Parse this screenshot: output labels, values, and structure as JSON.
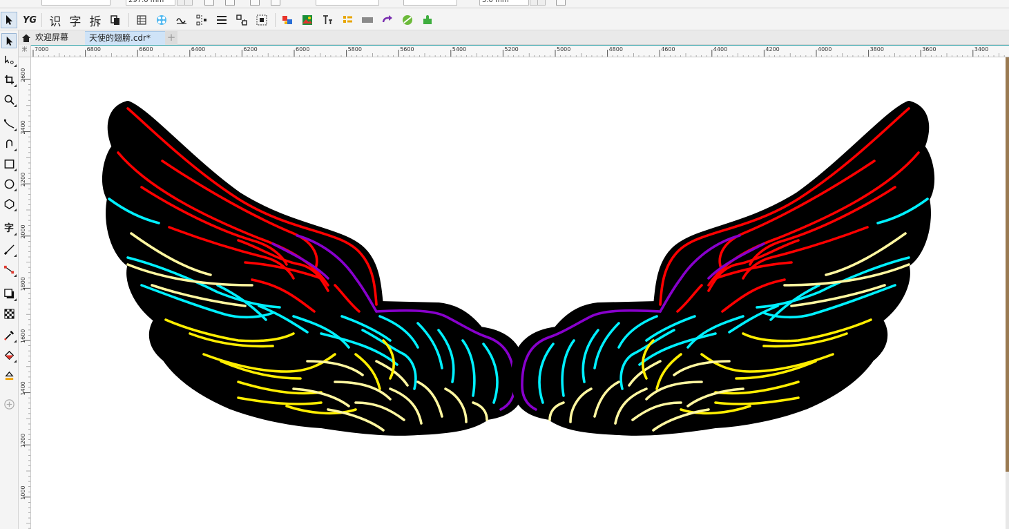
{
  "property_bar": {
    "width_value": "297.0 mm",
    "nudge_value": "5.0 mm"
  },
  "toolbar": {
    "items": [
      {
        "name": "pick-tool",
        "label": ""
      },
      {
        "name": "yg-plugin-icon",
        "label": "YG"
      },
      {
        "name": "recognize-button",
        "label": "识"
      },
      {
        "name": "character-button",
        "label": "字"
      },
      {
        "name": "split-button",
        "label": "拆"
      }
    ]
  },
  "tabs": {
    "home_label": "欢迎屏幕",
    "document_label": "天使的翅膀.cdr*",
    "add_label": "+"
  },
  "toolbox": {
    "text_tool_label": "字"
  },
  "ruler": {
    "unit_glyph": "米",
    "horizontal_labels": [
      "7000",
      "6800",
      "6600",
      "6400",
      "6200",
      "6000",
      "5800",
      "5600",
      "5400",
      "5200",
      "5000",
      "4800",
      "4600",
      "4400",
      "4200",
      "4000",
      "3800",
      "3600",
      "3400"
    ],
    "vertical_labels": [
      "2600",
      "2400",
      "2200",
      "2000",
      "1800",
      "1600",
      "1400",
      "1200",
      "1000"
    ]
  },
  "artwork": {
    "outline_color": "#000000",
    "feather_colors": {
      "red": "#ff0000",
      "purple": "#8800cc",
      "cyan": "#00f0ff",
      "yellow": "#ffee00",
      "pale_yellow": "#fff7a0"
    }
  }
}
